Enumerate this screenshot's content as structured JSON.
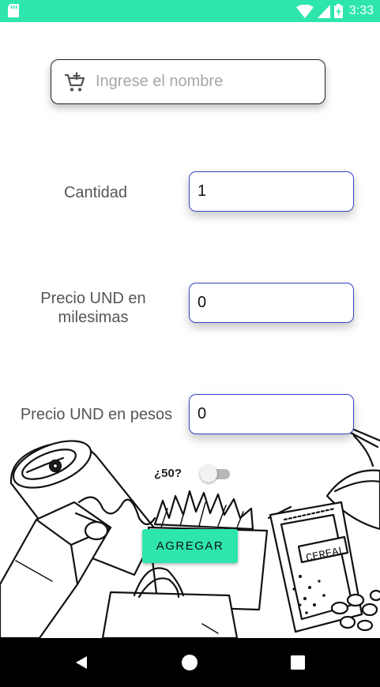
{
  "status_bar": {
    "time": "3:33",
    "icons": [
      "sd-card-icon",
      "wifi-icon",
      "signal-icon",
      "battery-charging-icon"
    ]
  },
  "name_field": {
    "placeholder": "Ingrese el nombre",
    "value": "",
    "icon": "add-shopping-cart-icon"
  },
  "form": {
    "cantidad": {
      "label": "Cantidad",
      "value": "1"
    },
    "precio_milesimas": {
      "label_line1": "Precio UND en",
      "label_line2": "milesimas",
      "value": "0"
    },
    "precio_pesos": {
      "label": "Precio UND en pesos",
      "value": "0"
    }
  },
  "toggle": {
    "label": "¿50?",
    "checked": false
  },
  "add_button": {
    "label": "AGREGAR"
  },
  "illustration": {
    "cereal_box_text": "CEREAL"
  },
  "nav_bar": {
    "icons": [
      "back-icon",
      "home-icon",
      "recents-icon"
    ]
  },
  "colors": {
    "accent": "#2ee6ad",
    "field_border": "#3245c9",
    "label_text": "#555555",
    "nav_background": "#000000"
  }
}
